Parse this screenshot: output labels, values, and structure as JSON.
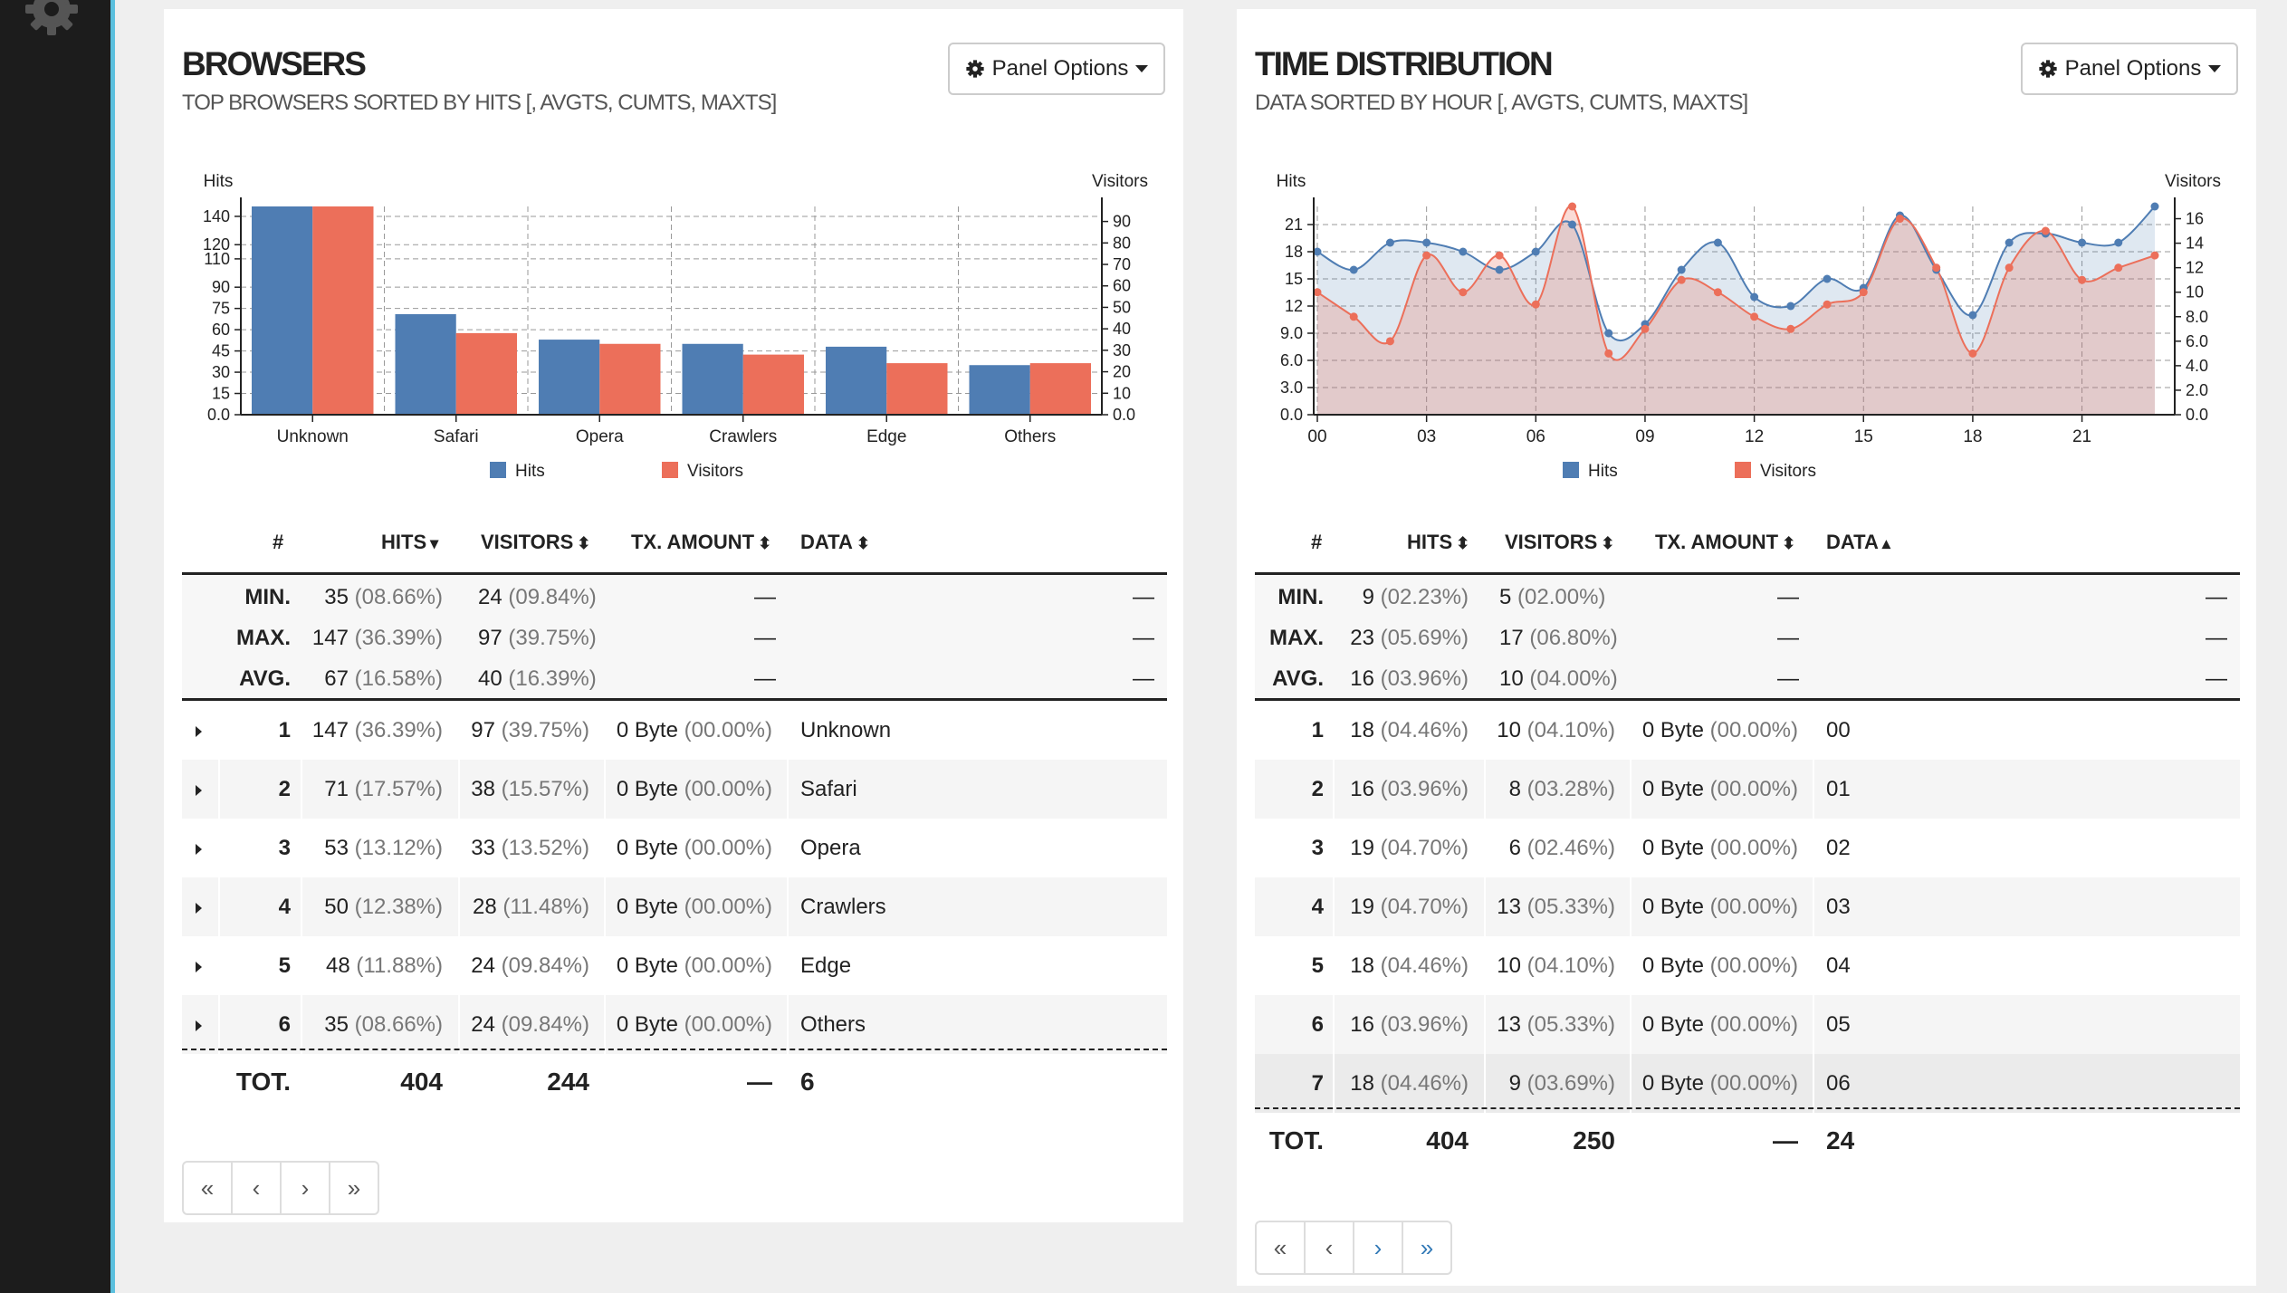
{
  "browsers": {
    "title": "BROWSERS",
    "subtitle": "TOP BROWSERS SORTED BY HITS [, AVGTS, CUMTS, MAXTS]",
    "panel_options": "Panel Options",
    "headers": {
      "idx": "#",
      "hits": "HITS",
      "visitors": "VISITORS",
      "tx": "TX. AMOUNT",
      "data": "DATA"
    },
    "stats": {
      "min": {
        "label": "MIN.",
        "hits": "35",
        "hits_pct": "(08.66%)",
        "visitors": "24",
        "visitors_pct": "(09.84%)",
        "tx": "—",
        "data": "—"
      },
      "max": {
        "label": "MAX.",
        "hits": "147",
        "hits_pct": "(36.39%)",
        "visitors": "97",
        "visitors_pct": "(39.75%)",
        "tx": "—",
        "data": "—"
      },
      "avg": {
        "label": "AVG.",
        "hits": "67",
        "hits_pct": "(16.58%)",
        "visitors": "40",
        "visitors_pct": "(16.39%)",
        "tx": "—",
        "data": "—"
      }
    },
    "rows": [
      {
        "idx": "1",
        "hits": "147",
        "hits_pct": "(36.39%)",
        "visitors": "97",
        "visitors_pct": "(39.75%)",
        "tx": "0 Byte",
        "tx_pct": "(00.00%)",
        "data": "Unknown"
      },
      {
        "idx": "2",
        "hits": "71",
        "hits_pct": "(17.57%)",
        "visitors": "38",
        "visitors_pct": "(15.57%)",
        "tx": "0 Byte",
        "tx_pct": "(00.00%)",
        "data": "Safari"
      },
      {
        "idx": "3",
        "hits": "53",
        "hits_pct": "(13.12%)",
        "visitors": "33",
        "visitors_pct": "(13.52%)",
        "tx": "0 Byte",
        "tx_pct": "(00.00%)",
        "data": "Opera"
      },
      {
        "idx": "4",
        "hits": "50",
        "hits_pct": "(12.38%)",
        "visitors": "28",
        "visitors_pct": "(11.48%)",
        "tx": "0 Byte",
        "tx_pct": "(00.00%)",
        "data": "Crawlers"
      },
      {
        "idx": "5",
        "hits": "48",
        "hits_pct": "(11.88%)",
        "visitors": "24",
        "visitors_pct": "(09.84%)",
        "tx": "0 Byte",
        "tx_pct": "(00.00%)",
        "data": "Edge"
      },
      {
        "idx": "6",
        "hits": "35",
        "hits_pct": "(08.66%)",
        "visitors": "24",
        "visitors_pct": "(09.84%)",
        "tx": "0 Byte",
        "tx_pct": "(00.00%)",
        "data": "Others"
      }
    ],
    "totals": {
      "label": "TOT.",
      "hits": "404",
      "visitors": "244",
      "tx": "—",
      "data": "6"
    },
    "pager": {
      "first": "«",
      "prev": "‹",
      "next": "›",
      "last": "»"
    }
  },
  "time": {
    "title": "TIME DISTRIBUTION",
    "subtitle": "DATA SORTED BY HOUR [, AVGTS, CUMTS, MAXTS]",
    "panel_options": "Panel Options",
    "headers": {
      "idx": "#",
      "hits": "HITS",
      "visitors": "VISITORS",
      "tx": "TX. AMOUNT",
      "data": "DATA"
    },
    "stats": {
      "min": {
        "label": "MIN.",
        "hits": "9",
        "hits_pct": "(02.23%)",
        "visitors": "5",
        "visitors_pct": "(02.00%)",
        "tx": "—",
        "data": "—"
      },
      "max": {
        "label": "MAX.",
        "hits": "23",
        "hits_pct": "(05.69%)",
        "visitors": "17",
        "visitors_pct": "(06.80%)",
        "tx": "—",
        "data": "—"
      },
      "avg": {
        "label": "AVG.",
        "hits": "16",
        "hits_pct": "(03.96%)",
        "visitors": "10",
        "visitors_pct": "(04.00%)",
        "tx": "—",
        "data": "—"
      }
    },
    "rows": [
      {
        "idx": "1",
        "hits": "18",
        "hits_pct": "(04.46%)",
        "visitors": "10",
        "visitors_pct": "(04.10%)",
        "tx": "0 Byte",
        "tx_pct": "(00.00%)",
        "data": "00"
      },
      {
        "idx": "2",
        "hits": "16",
        "hits_pct": "(03.96%)",
        "visitors": "8",
        "visitors_pct": "(03.28%)",
        "tx": "0 Byte",
        "tx_pct": "(00.00%)",
        "data": "01"
      },
      {
        "idx": "3",
        "hits": "19",
        "hits_pct": "(04.70%)",
        "visitors": "6",
        "visitors_pct": "(02.46%)",
        "tx": "0 Byte",
        "tx_pct": "(00.00%)",
        "data": "02"
      },
      {
        "idx": "4",
        "hits": "19",
        "hits_pct": "(04.70%)",
        "visitors": "13",
        "visitors_pct": "(05.33%)",
        "tx": "0 Byte",
        "tx_pct": "(00.00%)",
        "data": "03"
      },
      {
        "idx": "5",
        "hits": "18",
        "hits_pct": "(04.46%)",
        "visitors": "10",
        "visitors_pct": "(04.10%)",
        "tx": "0 Byte",
        "tx_pct": "(00.00%)",
        "data": "04"
      },
      {
        "idx": "6",
        "hits": "16",
        "hits_pct": "(03.96%)",
        "visitors": "13",
        "visitors_pct": "(05.33%)",
        "tx": "0 Byte",
        "tx_pct": "(00.00%)",
        "data": "05"
      },
      {
        "idx": "7",
        "hits": "18",
        "hits_pct": "(04.46%)",
        "visitors": "9",
        "visitors_pct": "(03.69%)",
        "tx": "0 Byte",
        "tx_pct": "(00.00%)",
        "data": "06"
      }
    ],
    "totals": {
      "label": "TOT.",
      "hits": "404",
      "visitors": "250",
      "tx": "—",
      "data": "24"
    },
    "pager": {
      "first": "«",
      "prev": "‹",
      "next": "›",
      "last": "»"
    }
  },
  "icons": {
    "sidebar": "gear-icon",
    "panel_options": "gear-icon",
    "expand": "caret-right-icon",
    "sort_both": "sort-icon",
    "sort_desc": "sort-down-icon",
    "sort_asc": "sort-up-icon"
  },
  "colors": {
    "hits": "#4f7db3",
    "visitors": "#ec6f5a",
    "sidebar": "#1c1c1c",
    "sidebar_accent": "#5bc0de",
    "link": "#337ab7"
  },
  "chart_data": [
    {
      "type": "bar",
      "categories": [
        "Unknown",
        "Safari",
        "Opera",
        "Crawlers",
        "Edge",
        "Others"
      ],
      "series": [
        {
          "name": "Hits",
          "axis": "left",
          "values": [
            147,
            71,
            53,
            50,
            48,
            35
          ]
        },
        {
          "name": "Visitors",
          "axis": "right",
          "values": [
            97,
            38,
            33,
            28,
            24,
            24
          ]
        }
      ],
      "ylabel": "Hits",
      "y2label": "Visitors",
      "ylim": [
        0,
        147
      ],
      "y2lim": [
        0,
        97
      ],
      "yticks": [
        "0.0",
        "15",
        "30",
        "45",
        "60",
        "75",
        "90",
        "110",
        "120",
        "140"
      ],
      "y2ticks": [
        "0.0",
        "10",
        "20",
        "30",
        "40",
        "50",
        "60",
        "70",
        "80",
        "90"
      ],
      "legend": [
        "Hits",
        "Visitors"
      ],
      "legend_position": "bottom",
      "grid": true
    },
    {
      "type": "area",
      "x": [
        "00",
        "01",
        "02",
        "03",
        "04",
        "05",
        "06",
        "07",
        "08",
        "09",
        "10",
        "11",
        "12",
        "13",
        "14",
        "15",
        "16",
        "17",
        "18",
        "19",
        "20",
        "21",
        "22",
        "23"
      ],
      "series": [
        {
          "name": "Hits",
          "axis": "left",
          "values": [
            18,
            16,
            19,
            19,
            18,
            16,
            18,
            21,
            9,
            10,
            16,
            19,
            13,
            12,
            15,
            14,
            22,
            16,
            11,
            19,
            20,
            19,
            19,
            23
          ]
        },
        {
          "name": "Visitors",
          "axis": "right",
          "values": [
            10,
            8,
            6,
            13,
            10,
            13,
            9,
            17,
            5,
            7,
            11,
            10,
            8,
            7,
            9,
            10,
            16,
            12,
            5,
            12,
            15,
            11,
            12,
            13
          ]
        }
      ],
      "xticks": [
        "00",
        "03",
        "06",
        "09",
        "12",
        "15",
        "18",
        "21"
      ],
      "ylabel": "Hits",
      "y2label": "Visitors",
      "ylim": [
        0,
        23
      ],
      "y2lim": [
        0,
        17
      ],
      "yticks": [
        "0.0",
        "3.0",
        "6.0",
        "9.0",
        "12",
        "15",
        "18",
        "21"
      ],
      "y2ticks": [
        "0.0",
        "2.0",
        "4.0",
        "6.0",
        "8.0",
        "10",
        "12",
        "14",
        "16"
      ],
      "legend": [
        "Hits",
        "Visitors"
      ],
      "legend_position": "bottom",
      "grid": true
    }
  ]
}
